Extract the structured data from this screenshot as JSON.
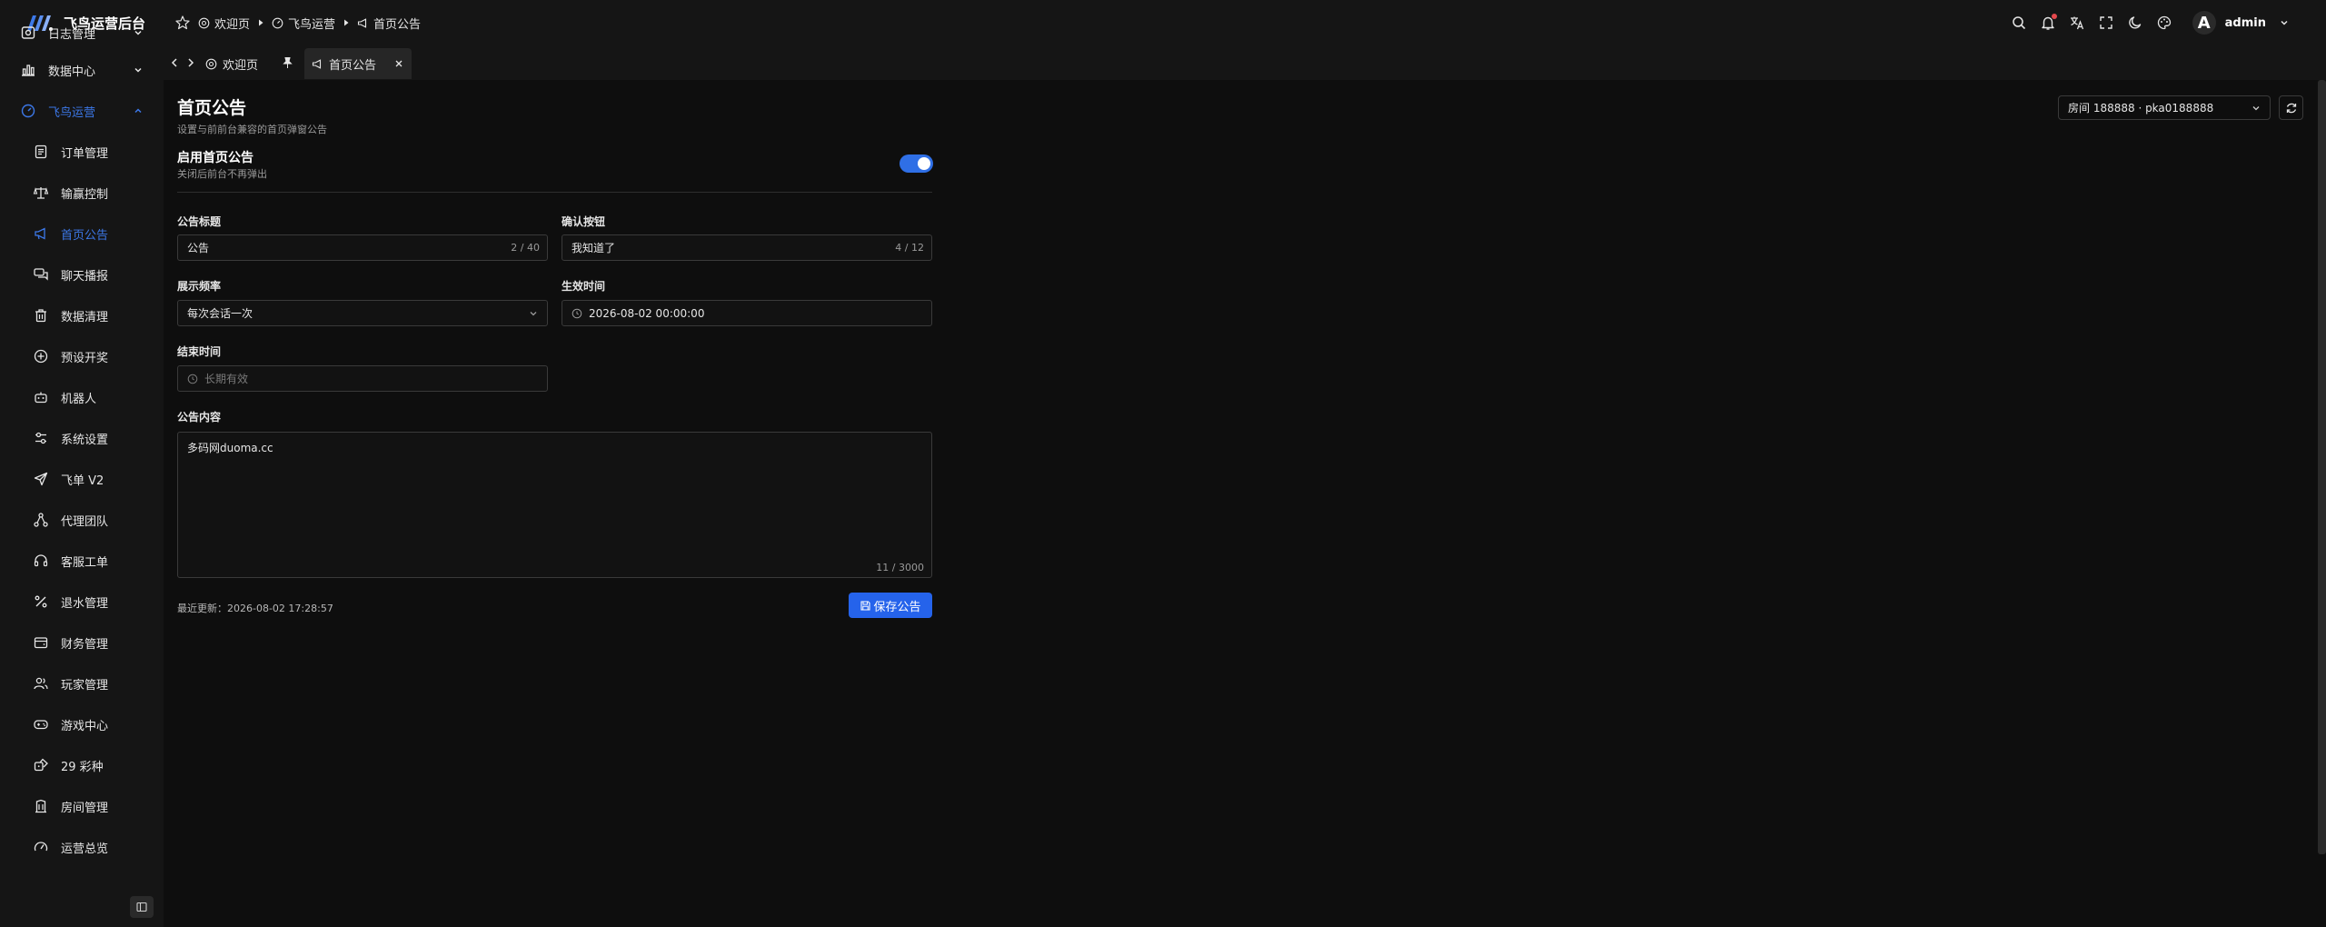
{
  "app": {
    "name": "飞鸟运营后台"
  },
  "colors": {
    "accent": "#3c78e8",
    "primary_button": "#2563eb",
    "notification_dot": "#e5484d"
  },
  "sidebar": {
    "items": [
      {
        "label": "日志管理",
        "icon": "log-icon"
      },
      {
        "label": "数据中心",
        "icon": "bar-chart-icon"
      },
      {
        "label": "飞鸟运营",
        "icon": "gauge-icon"
      },
      {
        "label": "订单管理",
        "icon": "order-icon"
      },
      {
        "label": "输赢控制",
        "icon": "scale-icon"
      },
      {
        "label": "首页公告",
        "icon": "megaphone-icon"
      },
      {
        "label": "聊天播报",
        "icon": "chat-icon"
      },
      {
        "label": "数据清理",
        "icon": "trash-icon"
      },
      {
        "label": "预设开奖",
        "icon": "plus-circle-icon"
      },
      {
        "label": "机器人",
        "icon": "robot-icon"
      },
      {
        "label": "系统设置",
        "icon": "sliders-icon"
      },
      {
        "label": "飞单 V2",
        "icon": "send-icon"
      },
      {
        "label": "代理团队",
        "icon": "network-icon"
      },
      {
        "label": "客服工单",
        "icon": "headset-icon"
      },
      {
        "label": "退水管理",
        "icon": "percent-icon"
      },
      {
        "label": "财务管理",
        "icon": "wallet-icon"
      },
      {
        "label": "玩家管理",
        "icon": "users-icon"
      },
      {
        "label": "游戏中心",
        "icon": "gamepad-icon"
      },
      {
        "label": "29 彩种",
        "icon": "dice-icon"
      },
      {
        "label": "房间管理",
        "icon": "building-icon"
      },
      {
        "label": "运营总览",
        "icon": "speedometer-icon"
      }
    ]
  },
  "header": {
    "breadcrumbs": [
      "欢迎页",
      "飞鸟运营",
      "首页公告"
    ],
    "username": "admin",
    "avatar_letter": "A"
  },
  "tabs": [
    {
      "label": "欢迎页"
    },
    {
      "label": "首页公告"
    }
  ],
  "page": {
    "title": "首页公告",
    "subtitle": "设置与前前台兼容的首页弹窗公告",
    "room_select": "房间 188888 · pka0188888",
    "enable": {
      "title": "启用首页公告",
      "subtitle": "关闭后前台不再弹出",
      "on": true
    },
    "fields": {
      "title": {
        "label": "公告标题",
        "value": "公告",
        "count": "2 / 40"
      },
      "confirm": {
        "label": "确认按钮",
        "value": "我知道了",
        "count": "4 / 12"
      },
      "frequency": {
        "label": "展示频率",
        "value": "每次会话一次"
      },
      "start_time": {
        "label": "生效时间",
        "value": "2026-08-02 00:00:00"
      },
      "end_time": {
        "label": "结束时间",
        "placeholder": "长期有效"
      },
      "content": {
        "label": "公告内容",
        "value": "多码网duoma.cc",
        "count": "11 / 3000"
      }
    },
    "last_update": "最近更新：2026-08-02 17:28:57",
    "save_label": "保存公告"
  }
}
